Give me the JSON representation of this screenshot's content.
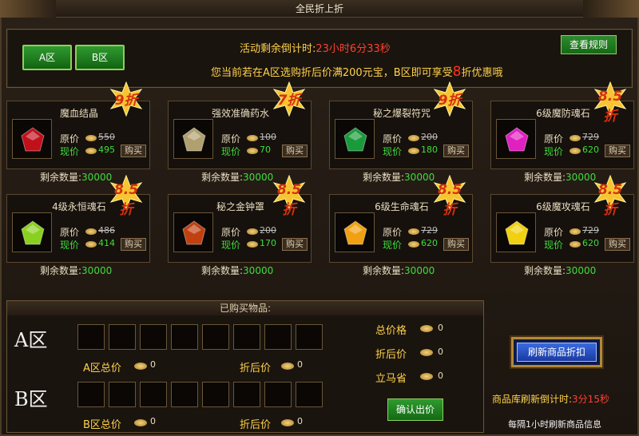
{
  "window": {
    "title": "全民折上折",
    "close": "×"
  },
  "top": {
    "zone_a": "A区",
    "zone_b": "B区",
    "countdown_label": "活动剩余倒计时:",
    "countdown_value": "23小时6分33秒",
    "promo_prefix": "您当前若在A区选购折后价满200元宝，B区即可享受",
    "promo_number": "8",
    "promo_suffix": "折优惠哦",
    "rules_button": "查看规则"
  },
  "labels": {
    "original": "原价",
    "current": "现价",
    "buy": "购买",
    "stock": "剩余数量:"
  },
  "items": [
    {
      "name": "魔血结晶",
      "old": "550",
      "new": "495",
      "discount": "9折",
      "stock": "30000",
      "gem": "#c0101a"
    },
    {
      "name": "强效准确药水",
      "old": "100",
      "new": "70",
      "discount": "7折",
      "stock": "30000",
      "gem": "#b0a070"
    },
    {
      "name": "秘之爆裂符咒",
      "old": "200",
      "new": "180",
      "discount": "9折",
      "stock": "30000",
      "gem": "#1a9a3a"
    },
    {
      "name": "6级魔防魂石",
      "old": "729",
      "new": "620",
      "discount": "8.5折",
      "stock": "30000",
      "gem": "#e020c0"
    },
    {
      "name": "4级永恒魂石",
      "old": "486",
      "new": "414",
      "discount": "8.5折",
      "stock": "30000",
      "gem": "#8ad020"
    },
    {
      "name": "秘之金钟罩",
      "old": "200",
      "new": "170",
      "discount": "8.5折",
      "stock": "30000",
      "gem": "#c04010"
    },
    {
      "name": "6级生命魂石",
      "old": "729",
      "new": "620",
      "discount": "8.5折",
      "stock": "30000",
      "gem": "#f0a010"
    },
    {
      "name": "6级魔攻魂石",
      "old": "729",
      "new": "620",
      "discount": "8.5折",
      "stock": "30000",
      "gem": "#f0d010"
    }
  ],
  "bought": {
    "header": "已购买物品:",
    "zone_a": "A区",
    "zone_b": "B区",
    "a_total_label": "A区总价",
    "a_total": "0",
    "a_disc_label": "折后价",
    "a_disc": "0",
    "b_total_label": "B区总价",
    "b_total": "0",
    "b_disc_label": "折后价",
    "b_disc": "0",
    "total_label": "总价格",
    "total": "0",
    "disc_label": "折后价",
    "disc": "0",
    "save_label": "立马省",
    "save": "0",
    "confirm": "确认出价"
  },
  "refresh": {
    "button": "刷新商品折扣",
    "count_label": "商品库刷新倒计时:",
    "count_value": "3分15秒",
    "info": "每隔1小时刷新商品信息"
  }
}
